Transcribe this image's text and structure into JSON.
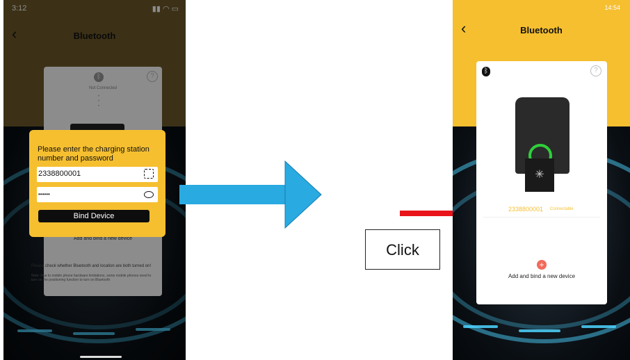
{
  "left_phone": {
    "status_time": "3:12",
    "nav_title": "Bluetooth",
    "card": {
      "status_text": "Not Connected",
      "add_device_label": "Add and bind a new device",
      "help_text": "Please check whether Bluetooth and location are both turned on!",
      "help_subtext": "Note: Due to mobile phone hardware limitations, some mobile phones need to turn on the positioning function to turn on Bluetooth"
    },
    "dialog": {
      "prompt": "Please enter the charging station number and password",
      "station_number": "2338800001",
      "password_masked": "••••••",
      "bind_button": "Bind Device"
    }
  },
  "right_phone": {
    "status_time": "14:54",
    "nav_title": "Bluetooth",
    "device_id": "2338800001",
    "device_status": "Connectable",
    "add_device_label": "Add and bind a new device"
  },
  "callout": {
    "click_label": "Click"
  },
  "colors": {
    "header_yellow_dim": "#6e5a2a",
    "header_yellow": "#f5bf30",
    "arrow_blue": "#29aae1",
    "arrow_red": "#e8141a",
    "ring_green": "#2fcf3a"
  }
}
